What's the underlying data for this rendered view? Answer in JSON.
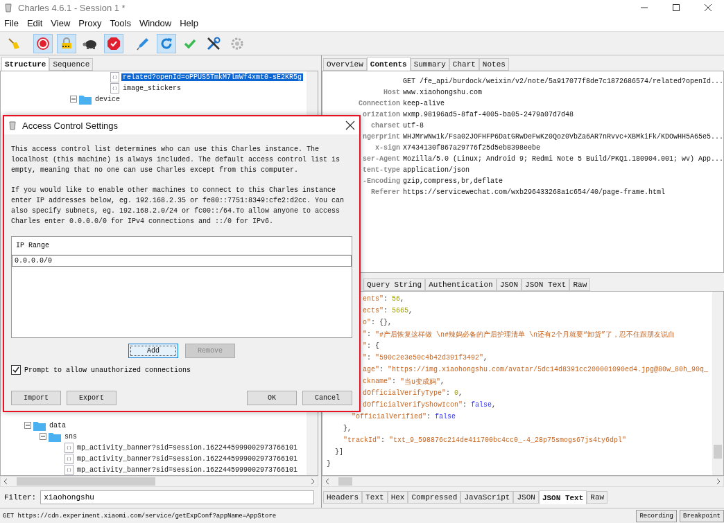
{
  "window": {
    "title": "Charles 4.6.1 - Session 1 *"
  },
  "menu": [
    "File",
    "Edit",
    "View",
    "Proxy",
    "Tools",
    "Window",
    "Help"
  ],
  "toolbar": [
    {
      "kind": "broom",
      "on": false
    },
    {
      "kind": "record",
      "on": true
    },
    {
      "kind": "ssl",
      "on": true
    },
    {
      "kind": "throttle",
      "on": false
    },
    {
      "kind": "breakpoints",
      "on": true
    },
    {
      "kind": "compose",
      "on": false
    },
    {
      "kind": "repeat",
      "on": true
    },
    {
      "kind": "validate",
      "on": false
    },
    {
      "kind": "tools",
      "on": false
    },
    {
      "kind": "settings",
      "on": false
    }
  ],
  "left_tabs": [
    {
      "label": "Structure",
      "selected": true
    },
    {
      "label": "Sequence",
      "selected": false
    }
  ],
  "tree_upper": [
    {
      "label": "related?openId=oPPUS5TmkM7lmWf4xmt0-sE2KR5g",
      "kind": "file",
      "selected": true
    },
    {
      "label": "image_stickers",
      "kind": "file",
      "selected": false
    },
    {
      "label": "device",
      "kind": "folder",
      "expanded": true,
      "selected": false
    }
  ],
  "tree_lower": [
    {
      "label": "data",
      "kind": "folder",
      "expanded": true,
      "selected": false,
      "children": [
        {
          "label": "sns",
          "kind": "folder",
          "expanded": true,
          "selected": false,
          "children": [
            {
              "label": "mp_activity_banner?sid=session.1622445999002973766101",
              "kind": "file",
              "selected": false
            },
            {
              "label": "mp_activity_banner?sid=session.1622445999002973766101",
              "kind": "file",
              "selected": false
            },
            {
              "label": "mp_activity_banner?sid=session.1622445999002973766101",
              "kind": "file",
              "selected": false
            }
          ]
        }
      ]
    }
  ],
  "filter": {
    "label": "Filter:",
    "value": "xiaohongshu"
  },
  "right_tabs": [
    {
      "label": "Overview",
      "selected": false
    },
    {
      "label": "Contents",
      "selected": true
    },
    {
      "label": "Summary",
      "selected": false
    },
    {
      "label": "Chart",
      "selected": false
    },
    {
      "label": "Notes",
      "selected": false
    }
  ],
  "headers": [
    {
      "value": "GET /fe_api/burdock/weixin/v2/note/5a917077f8de7c1872686574/related?openId..."
    },
    {
      "name": "Host",
      "value": "www.xiaohongshu.com"
    },
    {
      "name": "Connection",
      "value": "keep-alive"
    },
    {
      "name": "orization",
      "value": "wxmp.98196ad5-8faf-4005-ba05-2479a07d7d48"
    },
    {
      "name": "charset",
      "value": "utf-8"
    },
    {
      "name": "ngerprint",
      "value": "WHJMrwNw1k/Fsa02JOFHFP6DatGRwDeFwKz0Qoz0VbZa6AR7nRvvc+XBMkiFk/KDOwHH5A65e5..."
    },
    {
      "name": "x-sign",
      "value": "X7434130f867a29776f25d5eb8398eebe"
    },
    {
      "name": "ser-Agent",
      "value": "Mozilla/5.0 (Linux; Android 9; Redmi Note 5 Build/PKQ1.180904.001; wv) App..."
    },
    {
      "name": "tent-type",
      "value": "application/json"
    },
    {
      "name": "-Encoding",
      "value": "gzip,compress,br,deflate"
    },
    {
      "name": "Referer",
      "value": "https://servicewechat.com/wxb296433268a1c654/40/page-frame.html"
    }
  ],
  "request_tabs": [
    {
      "label": "Query String",
      "selected": false
    },
    {
      "label": "Authentication",
      "selected": false
    },
    {
      "label": "JSON",
      "selected": false
    },
    {
      "label": "JSON Text",
      "selected": false
    },
    {
      "label": "Raw",
      "selected": false
    }
  ],
  "json_lines": [
    {
      "kind": "clipped",
      "tokens": [
        {
          "t": "ents\"",
          "kind": "key"
        },
        {
          "t": ": ",
          "kind": "punct"
        },
        {
          "t": "56",
          "kind": "number"
        },
        {
          "t": ",",
          "kind": "punct"
        }
      ]
    },
    {
      "kind": "clipped",
      "tokens": [
        {
          "t": "ects\"",
          "kind": "key"
        },
        {
          "t": ": ",
          "kind": "punct"
        },
        {
          "t": "5665",
          "kind": "number"
        },
        {
          "t": ",",
          "kind": "punct"
        }
      ]
    },
    {
      "kind": "clipped",
      "tokens": [
        {
          "t": "o\"",
          "kind": "key"
        },
        {
          "t": ": {},",
          "kind": "punct"
        }
      ]
    },
    {
      "kind": "clipped",
      "tokens": [
        {
          "t": "\"",
          "kind": "key"
        },
        {
          "t": ": ",
          "kind": "punct"
        },
        {
          "t": "\"#产后恢复这样做 \\n#辣妈必备的产后护理清单 \\n还有2个月就要“卸货”了，忍不住跟朋友说自",
          "kind": "string"
        }
      ]
    },
    {
      "kind": "clipped",
      "tokens": [
        {
          "t": "\"",
          "kind": "key"
        },
        {
          "t": ": {",
          "kind": "punct"
        }
      ]
    },
    {
      "kind": "clipped",
      "tokens": [
        {
          "t": "\"",
          "kind": "key"
        },
        {
          "t": ": ",
          "kind": "punct"
        },
        {
          "t": "\"590c2e3e50c4b42d391f3492\"",
          "kind": "string"
        },
        {
          "t": ",",
          "kind": "punct"
        }
      ]
    },
    {
      "kind": "clipped",
      "tokens": [
        {
          "t": "age\"",
          "kind": "key"
        },
        {
          "t": ": ",
          "kind": "punct"
        },
        {
          "t": "\"https://img.xiaohongshu.com/avatar/5dc14d8391cc200001090ed4.jpg@80w_80h_90q_",
          "kind": "string"
        }
      ]
    },
    {
      "kind": "clipped",
      "tokens": [
        {
          "t": "ckname\"",
          "kind": "key"
        },
        {
          "t": ": ",
          "kind": "punct"
        },
        {
          "t": "\"当u变成妈\"",
          "kind": "string"
        },
        {
          "t": ",",
          "kind": "punct"
        }
      ]
    },
    {
      "kind": "clipped",
      "tokens": [
        {
          "t": "dOfficialVerifyType\"",
          "kind": "key"
        },
        {
          "t": ": ",
          "kind": "punct"
        },
        {
          "t": "0",
          "kind": "number"
        },
        {
          "t": ",",
          "kind": "punct"
        }
      ]
    },
    {
      "kind": "clipped",
      "tokens": [
        {
          "t": "dOfficialVerifyShowIcon\"",
          "kind": "key"
        },
        {
          "t": ": ",
          "kind": "punct"
        },
        {
          "t": "false",
          "kind": "bool"
        },
        {
          "t": ",",
          "kind": "punct"
        }
      ]
    },
    {
      "kind": "full",
      "tokens": [
        {
          "t": "      \"officialVerified\"",
          "kind": "key"
        },
        {
          "t": ": ",
          "kind": "punct"
        },
        {
          "t": "false",
          "kind": "bool"
        }
      ]
    },
    {
      "kind": "full",
      "tokens": [
        {
          "t": "    },",
          "kind": "punct"
        }
      ]
    },
    {
      "kind": "full",
      "tokens": [
        {
          "t": "    \"trackId\"",
          "kind": "key"
        },
        {
          "t": ": ",
          "kind": "punct"
        },
        {
          "t": "\"txt_9_598876c214de411700bc4cc0_-4_28p75smogs67js4ty6dpl\"",
          "kind": "string"
        }
      ]
    },
    {
      "kind": "full",
      "tokens": [
        {
          "t": "  }]",
          "kind": "punct"
        }
      ]
    },
    {
      "kind": "full",
      "tokens": [
        {
          "t": "}",
          "kind": "punct"
        }
      ]
    }
  ],
  "bottom_tabs": [
    {
      "label": "Headers",
      "selected": false
    },
    {
      "label": "Text",
      "selected": false
    },
    {
      "label": "Hex",
      "selected": false
    },
    {
      "label": "Compressed",
      "selected": false
    },
    {
      "label": "JavaScript",
      "selected": false
    },
    {
      "label": "JSON",
      "selected": false
    },
    {
      "label": "JSON Text",
      "selected": true
    },
    {
      "label": "Raw",
      "selected": false
    }
  ],
  "status_bar": {
    "text": "GET https://cdn.experiment.xiaomi.com/service/getExpConf?appName=AppStore",
    "buttons": [
      "Recording",
      "Breakpoint"
    ]
  },
  "dialog": {
    "title": "Access Control Settings",
    "paragraphs": [
      "This access control list determines who can use this Charles instance. The localhost (this machine) is always included. The default access control list is empty, meaning that no one can use Charles except from this computer.",
      "If you would like to enable other machines to connect to this Charles instance enter IP addresses below, eg. 192.168.2.35 or fe80::7751:8349:cfe2:d2cc. You can also specify subnets, eg. 192.168.2.0/24 or fc00::/64.To allow anyone to access Charles enter 0.0.0.0/0 for IPv4 connections and ::/0 for IPv6."
    ],
    "table": {
      "column": "IP Range",
      "rows": [
        {
          "value": "0.0.0.0/0",
          "selected": true
        }
      ]
    },
    "list_buttons": [
      {
        "label": "Add",
        "disabled": false,
        "focused": true
      },
      {
        "label": "Remove",
        "disabled": true,
        "focused": false
      }
    ],
    "checkbox": {
      "label": "Prompt to allow unauthorized connections",
      "checked": true
    },
    "left_buttons": [
      "Import",
      "Export"
    ],
    "right_buttons": [
      "OK",
      "Cancel"
    ]
  }
}
